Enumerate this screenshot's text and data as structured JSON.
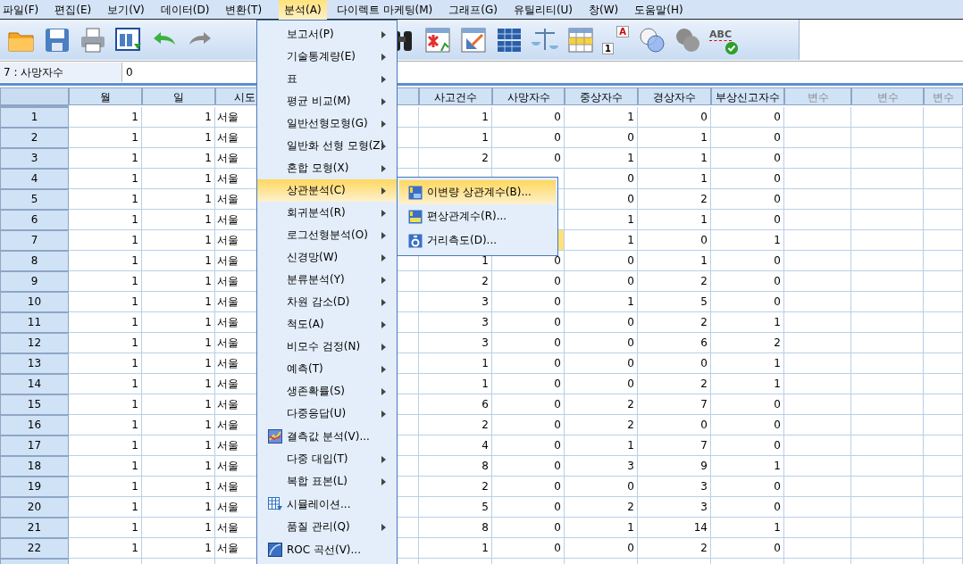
{
  "menubar": [
    {
      "label": "파일(F)",
      "selected": false
    },
    {
      "label": "편집(E)",
      "selected": false
    },
    {
      "label": "보기(V)",
      "selected": false
    },
    {
      "label": "데이터(D)",
      "selected": false
    },
    {
      "label": "변환(T)",
      "selected": false
    },
    {
      "label": "분석(A)",
      "selected": true
    },
    {
      "label": "다이렉트 마케팅(M)",
      "selected": false
    },
    {
      "label": "그래프(G)",
      "selected": false
    },
    {
      "label": "유틸리티(U)",
      "selected": false
    },
    {
      "label": "창(W)",
      "selected": false
    },
    {
      "label": "도움말(H)",
      "selected": false
    }
  ],
  "toolbar": {
    "value_labels_icon_texts": [
      "A",
      "1"
    ],
    "spelling_icon_text": "ABC"
  },
  "cell_editor": {
    "reference": "7 : 사망자수",
    "value": "0"
  },
  "grid": {
    "columns": [
      {
        "label": "월",
        "kind": "number"
      },
      {
        "label": "일",
        "kind": "number"
      },
      {
        "label": "시도",
        "kind": "text"
      },
      {
        "label": "사고건수",
        "kind": "number"
      },
      {
        "label": "사망자수",
        "kind": "number"
      },
      {
        "label": "중상자수",
        "kind": "number"
      },
      {
        "label": "경상자수",
        "kind": "number"
      },
      {
        "label": "부상신고자수",
        "kind": "number"
      },
      {
        "label": "변수",
        "kind": "blank"
      },
      {
        "label": "변수",
        "kind": "blank"
      },
      {
        "label": "변수",
        "kind": "blank"
      }
    ],
    "rows": [
      {
        "header": "1",
        "selected": false,
        "cells": [
          "1",
          "1",
          "서울",
          "1",
          "0",
          "1",
          "0",
          "0"
        ]
      },
      {
        "header": "2",
        "selected": false,
        "cells": [
          "1",
          "1",
          "서울",
          "1",
          "0",
          "0",
          "1",
          "0"
        ]
      },
      {
        "header": "3",
        "selected": false,
        "cells": [
          "1",
          "1",
          "서울",
          "2",
          "0",
          "1",
          "1",
          "0"
        ]
      },
      {
        "header": "4",
        "selected": false,
        "cells": [
          "1",
          "1",
          "서울",
          null,
          null,
          "0",
          "1",
          "0"
        ]
      },
      {
        "header": "5",
        "selected": false,
        "cells": [
          "1",
          "1",
          "서울",
          null,
          null,
          "0",
          "2",
          "0"
        ]
      },
      {
        "header": "6",
        "selected": false,
        "cells": [
          "1",
          "1",
          "서울",
          null,
          null,
          "1",
          "1",
          "0"
        ]
      },
      {
        "header": "7",
        "selected": false,
        "cells": [
          "1",
          "1",
          "서울",
          null,
          {
            "selected": true
          },
          "1",
          "0",
          "1"
        ]
      },
      {
        "header": "8",
        "selected": false,
        "cells": [
          "1",
          "1",
          "서울",
          "1",
          "0",
          "0",
          "1",
          "0"
        ]
      },
      {
        "header": "9",
        "selected": false,
        "cells": [
          "1",
          "1",
          "서울",
          "2",
          "0",
          "0",
          "2",
          "0"
        ]
      },
      {
        "header": "10",
        "selected": false,
        "cells": [
          "1",
          "1",
          "서울",
          "3",
          "0",
          "1",
          "5",
          "0"
        ]
      },
      {
        "header": "11",
        "selected": false,
        "cells": [
          "1",
          "1",
          "서울",
          "3",
          "0",
          "0",
          "2",
          "1"
        ]
      },
      {
        "header": "12",
        "selected": false,
        "cells": [
          "1",
          "1",
          "서울",
          "3",
          "0",
          "0",
          "6",
          "2"
        ]
      },
      {
        "header": "13",
        "selected": false,
        "cells": [
          "1",
          "1",
          "서울",
          "1",
          "0",
          "0",
          "0",
          "1"
        ]
      },
      {
        "header": "14",
        "selected": false,
        "cells": [
          "1",
          "1",
          "서울",
          "1",
          "0",
          "0",
          "2",
          "1"
        ]
      },
      {
        "header": "15",
        "selected": false,
        "cells": [
          "1",
          "1",
          "서울",
          "6",
          "0",
          "2",
          "7",
          "0"
        ]
      },
      {
        "header": "16",
        "selected": false,
        "cells": [
          "1",
          "1",
          "서울",
          "2",
          "0",
          "2",
          "0",
          "0"
        ]
      },
      {
        "header": "17",
        "selected": false,
        "cells": [
          "1",
          "1",
          "서울",
          "4",
          "0",
          "1",
          "7",
          "0"
        ]
      },
      {
        "header": "18",
        "selected": false,
        "cells": [
          "1",
          "1",
          "서울",
          "8",
          "0",
          "3",
          "9",
          "1"
        ]
      },
      {
        "header": "19",
        "selected": false,
        "cells": [
          "1",
          "1",
          "서울",
          "2",
          "0",
          "0",
          "3",
          "0"
        ]
      },
      {
        "header": "20",
        "selected": false,
        "cells": [
          "1",
          "1",
          "서울",
          "5",
          "0",
          "2",
          "3",
          "0"
        ]
      },
      {
        "header": "21",
        "selected": false,
        "cells": [
          "1",
          "1",
          "서울",
          "8",
          "0",
          "1",
          "14",
          "1"
        ]
      },
      {
        "header": "22",
        "selected": false,
        "cells": [
          "1",
          "1",
          "서울",
          "1",
          "0",
          "0",
          "2",
          "0"
        ]
      }
    ]
  },
  "analyze_menu": {
    "items": [
      {
        "label": "보고서(P)",
        "kind": "submenu",
        "selected": false
      },
      {
        "label": "기술통계량(E)",
        "kind": "submenu",
        "selected": false
      },
      {
        "label": "표",
        "kind": "submenu",
        "selected": false
      },
      {
        "label": "평균 비교(M)",
        "kind": "submenu",
        "selected": false
      },
      {
        "label": "일반선형모형(G)",
        "kind": "submenu",
        "selected": false
      },
      {
        "label": "일반화 선형 모형(Z)",
        "kind": "submenu",
        "selected": false
      },
      {
        "label": "혼합 모형(X)",
        "kind": "submenu",
        "selected": false
      },
      {
        "label": "상관분석(C)",
        "kind": "submenu",
        "selected": true,
        "submenu": [
          {
            "label": "이변량 상관계수(B)...",
            "selected": true
          },
          {
            "label": "편상관계수(R)...",
            "selected": false
          },
          {
            "label": "거리측도(D)...",
            "selected": false
          }
        ]
      },
      {
        "label": "회귀분석(R)",
        "kind": "submenu",
        "selected": false
      },
      {
        "label": "로그선형분석(O)",
        "kind": "submenu",
        "selected": false
      },
      {
        "label": "신경망(W)",
        "kind": "submenu",
        "selected": false
      },
      {
        "label": "분류분석(Y)",
        "kind": "submenu",
        "selected": false
      },
      {
        "label": "차원 감소(D)",
        "kind": "submenu",
        "selected": false
      },
      {
        "label": "척도(A)",
        "kind": "submenu",
        "selected": false
      },
      {
        "label": "비모수 검정(N)",
        "kind": "submenu",
        "selected": false
      },
      {
        "label": "예측(T)",
        "kind": "submenu",
        "selected": false
      },
      {
        "label": "생존확률(S)",
        "kind": "submenu",
        "selected": false
      },
      {
        "label": "다중응답(U)",
        "kind": "submenu",
        "selected": false
      },
      {
        "label": "결측값 분석(V)...",
        "kind": "action",
        "selected": false
      },
      {
        "label": "다중 대입(T)",
        "kind": "submenu",
        "selected": false
      },
      {
        "label": "복합 표본(L)",
        "kind": "submenu",
        "selected": false
      },
      {
        "label": "시뮬레이션...",
        "kind": "action",
        "selected": false
      },
      {
        "label": "품질 관리(Q)",
        "kind": "submenu",
        "selected": false
      },
      {
        "label": "ROC 곡선(V)...",
        "kind": "action",
        "selected": false
      }
    ]
  }
}
